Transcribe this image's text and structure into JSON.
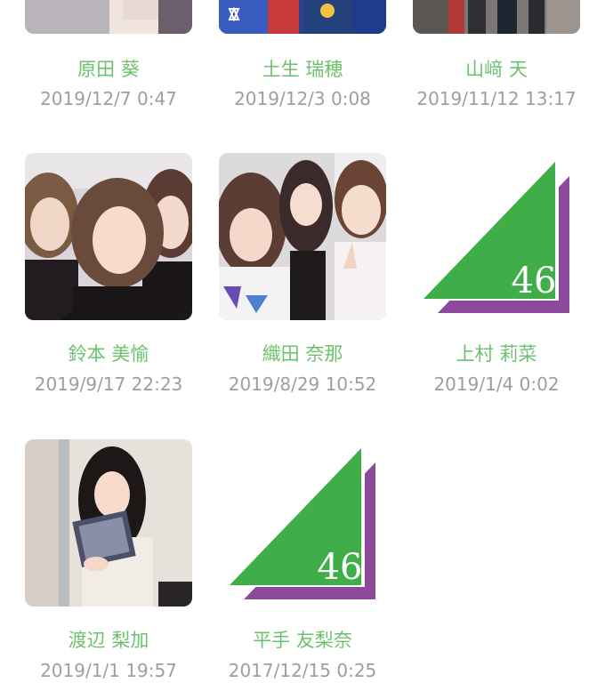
{
  "members": [
    {
      "name": "原田 葵",
      "date": "2019/12/7 0:47",
      "thumb": "photo"
    },
    {
      "name": "土生 瑞穂",
      "date": "2019/12/3 0:08",
      "thumb": "photo"
    },
    {
      "name": "山﨑 天",
      "date": "2019/11/12 13:17",
      "thumb": "photo"
    },
    {
      "name": "鈴本 美愉",
      "date": "2019/9/17 22:23",
      "thumb": "photo"
    },
    {
      "name": "織田 奈那",
      "date": "2019/8/29 10:52",
      "thumb": "photo"
    },
    {
      "name": "上村 莉菜",
      "date": "2019/1/4 0:02",
      "thumb": "logo"
    },
    {
      "name": "渡辺 梨加",
      "date": "2019/1/1 19:57",
      "thumb": "photo"
    },
    {
      "name": "平手 友梨奈",
      "date": "2017/12/15 0:25",
      "thumb": "logo"
    }
  ],
  "logo_text": "46",
  "colors": {
    "name_green": "#6dc16d",
    "date_gray": "#9e9e9e",
    "logo_green": "#3fae49",
    "logo_purple": "#8b4a9c"
  }
}
